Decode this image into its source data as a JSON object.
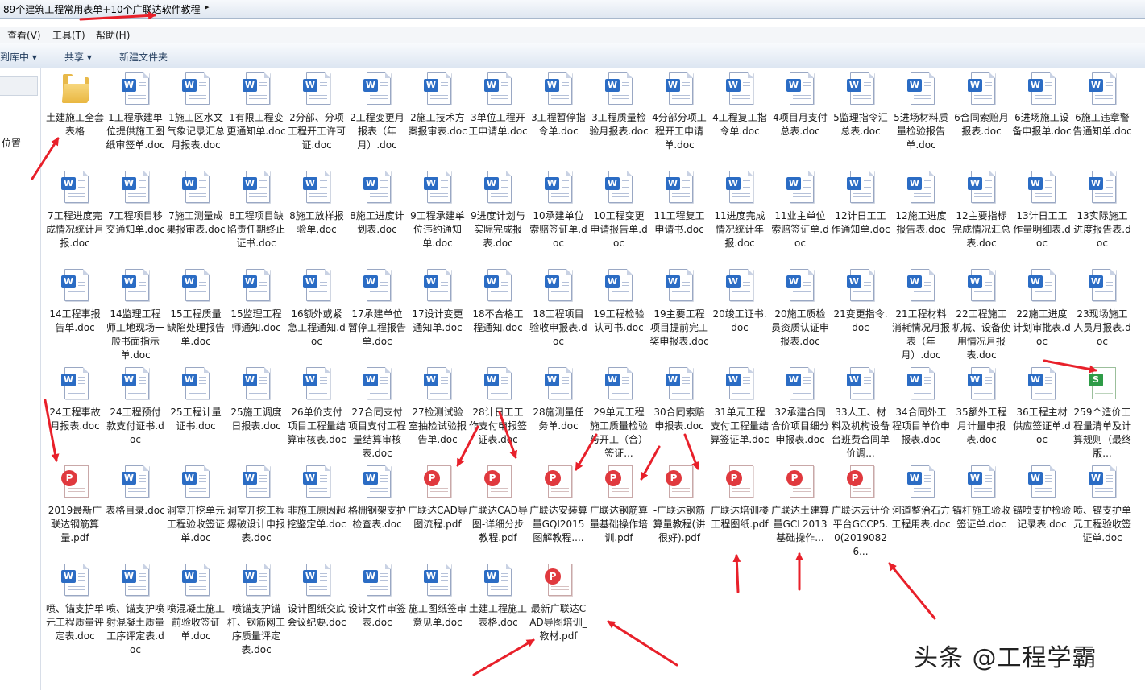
{
  "address_bar": {
    "path": "89个建筑工程常用表单+10个广联达软件教程",
    "arrow": "▸"
  },
  "menu": [
    "查看(V)",
    "工具(T)",
    "帮助(H)"
  ],
  "toolbar": {
    "library": "到库中 ▾",
    "share": "共享 ▾",
    "new_folder": "新建文件夹"
  },
  "nav": {
    "location": "位置"
  },
  "watermark": "头条 @工程学霸",
  "colors": {
    "word": "#2b6cc4",
    "pdf": "#e0393e",
    "xls": "#2e9b47",
    "arrow": "#e8202a"
  },
  "files": [
    {
      "name": "土建施工全套表格",
      "type": "folder"
    },
    {
      "name": "1工程承建单位提供施工图纸审签单.doc",
      "type": "doc"
    },
    {
      "name": "1施工区水文气象记录汇总月报表.doc",
      "type": "doc"
    },
    {
      "name": "1有限工程变更通知单.doc",
      "type": "doc"
    },
    {
      "name": "2分部、分项工程开工许可证.doc",
      "type": "doc"
    },
    {
      "name": "2工程变更月报表（年　月）.doc",
      "type": "doc"
    },
    {
      "name": "2施工技术方案报审表.doc",
      "type": "doc"
    },
    {
      "name": "3单位工程开工申请单.doc",
      "type": "doc"
    },
    {
      "name": "3工程暂停指令单.doc",
      "type": "doc"
    },
    {
      "name": "3工程质量检验月报表.doc",
      "type": "doc"
    },
    {
      "name": "4分部分项工程开工申请单.doc",
      "type": "doc"
    },
    {
      "name": "4工程复工指令单.doc",
      "type": "doc"
    },
    {
      "name": "4项目月支付总表.doc",
      "type": "doc"
    },
    {
      "name": "5监理指令汇总表.doc",
      "type": "doc"
    },
    {
      "name": "5进场材料质量检验报告单.doc",
      "type": "doc"
    },
    {
      "name": "6合同索赔月报表.doc",
      "type": "doc"
    },
    {
      "name": "6进场施工设备申报单.doc",
      "type": "doc"
    },
    {
      "name": "6施工违章警告通知单.doc",
      "type": "doc"
    },
    {
      "name": "7工程进度完成情况统计月报.doc",
      "type": "doc"
    },
    {
      "name": "7工程项目移交通知单.doc",
      "type": "doc"
    },
    {
      "name": "7施工测量成果报审表.doc",
      "type": "doc"
    },
    {
      "name": "8工程项目缺陷责任期终止证书.doc",
      "type": "doc"
    },
    {
      "name": "8施工放样报验单.doc",
      "type": "doc"
    },
    {
      "name": "8施工进度计划表.doc",
      "type": "doc"
    },
    {
      "name": "9工程承建单位违约通知单.doc",
      "type": "doc"
    },
    {
      "name": "9进度计划与实际完成报表.doc",
      "type": "doc"
    },
    {
      "name": "10承建单位索赔签证单.doc",
      "type": "doc"
    },
    {
      "name": "10工程变更申请报告单.doc",
      "type": "doc"
    },
    {
      "name": "11工程复工申请书.doc",
      "type": "doc"
    },
    {
      "name": "11进度完成情况统计年报.doc",
      "type": "doc"
    },
    {
      "name": "11业主单位索赔签证单.doc",
      "type": "doc"
    },
    {
      "name": "12计日工工作通知单.doc",
      "type": "doc"
    },
    {
      "name": "12施工进度报告表.doc",
      "type": "doc"
    },
    {
      "name": "12主要指标完成情况汇总表.doc",
      "type": "doc"
    },
    {
      "name": "13计日工工作量明细表.doc",
      "type": "doc"
    },
    {
      "name": "13实际施工进度报告表.doc",
      "type": "doc"
    },
    {
      "name": "14工程事报告单.doc",
      "type": "doc"
    },
    {
      "name": "14监理工程师工地现场一般书面指示单.doc",
      "type": "doc"
    },
    {
      "name": "15工程质量缺陷处理报告单.doc",
      "type": "doc"
    },
    {
      "name": "15监理工程师通知.doc",
      "type": "doc"
    },
    {
      "name": "16额外或紧急工程通知.doc",
      "type": "doc"
    },
    {
      "name": "17承建单位暂停工程报告单.doc",
      "type": "doc"
    },
    {
      "name": "17设计变更通知单.doc",
      "type": "doc"
    },
    {
      "name": "18不合格工程通知.doc",
      "type": "doc"
    },
    {
      "name": "18工程项目验收申报表.doc",
      "type": "doc"
    },
    {
      "name": "19工程检验认可书.doc",
      "type": "doc"
    },
    {
      "name": "19主要工程项目提前完工奖申报表.doc",
      "type": "doc"
    },
    {
      "name": "20竣工证书.doc",
      "type": "doc"
    },
    {
      "name": "20施工质检员资质认证申报表.doc",
      "type": "doc"
    },
    {
      "name": "21变更指令.doc",
      "type": "doc"
    },
    {
      "name": "21工程材料消耗情况月报表（年　月）.doc",
      "type": "doc"
    },
    {
      "name": "22工程施工机械、设备使用情况月报表.doc",
      "type": "doc"
    },
    {
      "name": "22施工进度计划审批表.doc",
      "type": "doc"
    },
    {
      "name": "23现场施工人员月报表.doc",
      "type": "doc"
    },
    {
      "name": "24工程事故月报表.doc",
      "type": "doc"
    },
    {
      "name": "24工程预付款支付证书.doc",
      "type": "doc"
    },
    {
      "name": "25工程计量证书.doc",
      "type": "doc"
    },
    {
      "name": "25施工调度日报表.doc",
      "type": "doc"
    },
    {
      "name": "26单价支付项目工程量结算审核表.doc",
      "type": "doc"
    },
    {
      "name": "27合同支付项目支付工程量结算审核表.doc",
      "type": "doc"
    },
    {
      "name": "27检测试验室抽检试验报告单.doc",
      "type": "doc"
    },
    {
      "name": "28计日工工作支付申报签证表.doc",
      "type": "doc"
    },
    {
      "name": "28施测量任务单.doc",
      "type": "doc"
    },
    {
      "name": "29单元工程施工质量检验与开工（合）签证...",
      "type": "doc"
    },
    {
      "name": "30合同索赔申报表.doc",
      "type": "doc"
    },
    {
      "name": "31单元工程支付工程量结算签证单.doc",
      "type": "doc"
    },
    {
      "name": "32承建合同合价项目细分申报表.doc",
      "type": "doc"
    },
    {
      "name": "33人工、材料及机构设备台班费合同单价调...",
      "type": "doc"
    },
    {
      "name": "34合同外工程项目单价申报表.doc",
      "type": "doc"
    },
    {
      "name": "35额外工程月计量申报表.doc",
      "type": "doc"
    },
    {
      "name": "36工程主材供应签证单.doc",
      "type": "doc"
    },
    {
      "name": "259个造价工程量清单及计算规则（最终版...",
      "type": "xls"
    },
    {
      "name": "2019最新广联达钢筋算量.pdf",
      "type": "pdf"
    },
    {
      "name": "表格目录.doc",
      "type": "doc"
    },
    {
      "name": "洞室开挖单元工程验收签证单.doc",
      "type": "doc"
    },
    {
      "name": "洞室开挖工程爆破设计申报表.doc",
      "type": "doc"
    },
    {
      "name": "非施工原因超挖鉴定单.doc",
      "type": "doc"
    },
    {
      "name": "格栅钢架支护检查表.doc",
      "type": "doc"
    },
    {
      "name": "广联达CAD导图流程.pdf",
      "type": "pdf"
    },
    {
      "name": "广联达CAD导图-详细分步教程.pdf",
      "type": "pdf"
    },
    {
      "name": "广联达安装算量GQI2015图解教程....",
      "type": "pdf"
    },
    {
      "name": "广联达钢筋算量基础操作培训.pdf",
      "type": "pdf"
    },
    {
      "name": "-广联达钢筋算量教程(讲很好).pdf",
      "type": "pdf"
    },
    {
      "name": "广联达培训楼工程图纸.pdf",
      "type": "pdf"
    },
    {
      "name": "广联达土建算量GCL2013基础操作...",
      "type": "pdf"
    },
    {
      "name": "广联达云计价平台GCCP5.0(20190826...",
      "type": "pdf"
    },
    {
      "name": "河道整治石方工程用表.doc",
      "type": "doc"
    },
    {
      "name": "锚杆施工验收签证单.doc",
      "type": "doc"
    },
    {
      "name": "锚喷支护检验记录表.doc",
      "type": "doc"
    },
    {
      "name": "喷、锚支护单元工程验收签证单.doc",
      "type": "doc"
    },
    {
      "name": "喷、锚支护单元工程质量评定表.doc",
      "type": "doc"
    },
    {
      "name": "喷、锚支护喷射混凝土质量工序评定表.doc",
      "type": "doc"
    },
    {
      "name": "喷混凝土施工前验收签证单.doc",
      "type": "doc"
    },
    {
      "name": "喷锚支护锚杆、钢筋网工序质量评定表.doc",
      "type": "doc"
    },
    {
      "name": "设计图纸交底会议纪要.doc",
      "type": "doc"
    },
    {
      "name": "设计文件审签表.doc",
      "type": "doc"
    },
    {
      "name": "施工图纸签审意见单.doc",
      "type": "doc"
    },
    {
      "name": "土建工程施工表格.doc",
      "type": "doc"
    },
    {
      "name": "最新广联达CAD导图培训_教材.pdf",
      "type": "pdf"
    }
  ]
}
